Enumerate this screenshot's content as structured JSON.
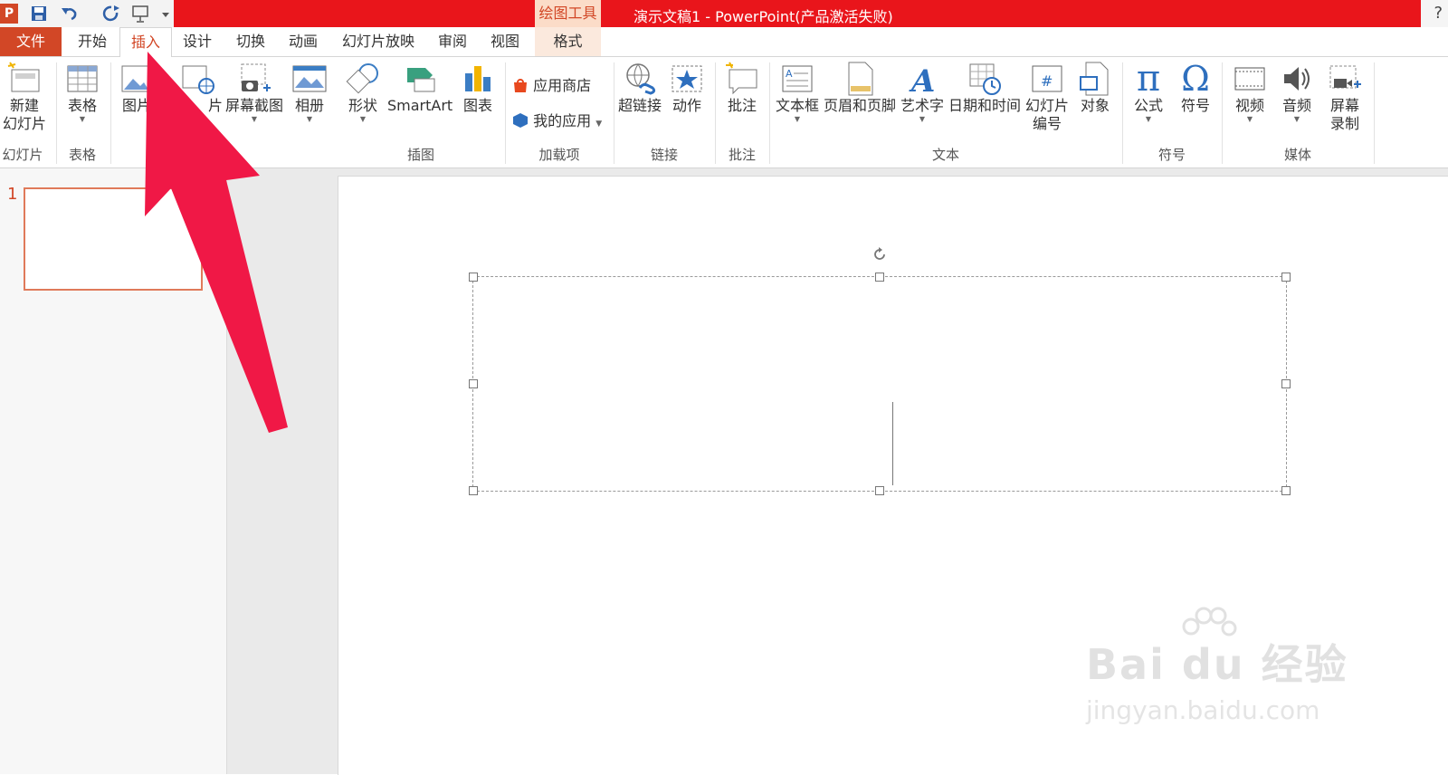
{
  "window": {
    "title": "演示文稿1 - PowerPoint(产品激活失败)",
    "context_tab_group": "绘图工具",
    "help": "?",
    "app_logo": "P"
  },
  "quick_access": [
    "save-icon",
    "undo-icon",
    "redo-icon",
    "present-icon",
    "customize-icon"
  ],
  "tabs": [
    {
      "label": "文件",
      "state": "file"
    },
    {
      "label": "开始"
    },
    {
      "label": "插入",
      "state": "active"
    },
    {
      "label": "设计"
    },
    {
      "label": "切换"
    },
    {
      "label": "动画"
    },
    {
      "label": "幻灯片放映"
    },
    {
      "label": "审阅"
    },
    {
      "label": "视图"
    },
    {
      "label": "格式",
      "state": "context"
    }
  ],
  "ribbon": {
    "new_slide": {
      "label1": "新建",
      "label2": "幻灯片",
      "group": "幻灯片"
    },
    "table": {
      "label": "表格",
      "group": "表格"
    },
    "pictures": {
      "label": "图片"
    },
    "online_pictures": {
      "label": "片"
    },
    "screenshot": {
      "label": "屏幕截图"
    },
    "album": {
      "label": "相册"
    },
    "shapes": {
      "label": "形状"
    },
    "smartart": {
      "label": "SmartArt"
    },
    "chart": {
      "label": "图表"
    },
    "illustrations_group": "插图",
    "store": {
      "label": "应用商店"
    },
    "my_apps": {
      "label": "我的应用"
    },
    "addins_group": "加载项",
    "hyperlink": {
      "label": "超链接"
    },
    "action": {
      "label": "动作"
    },
    "links_group": "链接",
    "comment": {
      "label": "批注"
    },
    "comments_group": "批注",
    "textbox": {
      "label": "文本框"
    },
    "header_footer": {
      "label": "页眉和页脚"
    },
    "wordart": {
      "label": "艺术字"
    },
    "datetime": {
      "label": "日期和时间"
    },
    "slide_number": {
      "label1": "幻灯片",
      "label2": "编号"
    },
    "object": {
      "label": "对象"
    },
    "text_group": "文本",
    "equation": {
      "label": "公式"
    },
    "symbol": {
      "label": "符号"
    },
    "symbols_group": "符号",
    "video": {
      "label": "视频"
    },
    "audio": {
      "label": "音频"
    },
    "screen_recording": {
      "label1": "屏幕",
      "label2": "录制"
    },
    "media_group": "媒体"
  },
  "thumbnails": {
    "slide_number": "1"
  },
  "watermark": {
    "logo": "Bai du 经验",
    "url": "jingyan.baidu.com"
  },
  "colors": {
    "accent": "#d24726",
    "titlebar": "#e9151b",
    "arrow": "#f01846"
  }
}
